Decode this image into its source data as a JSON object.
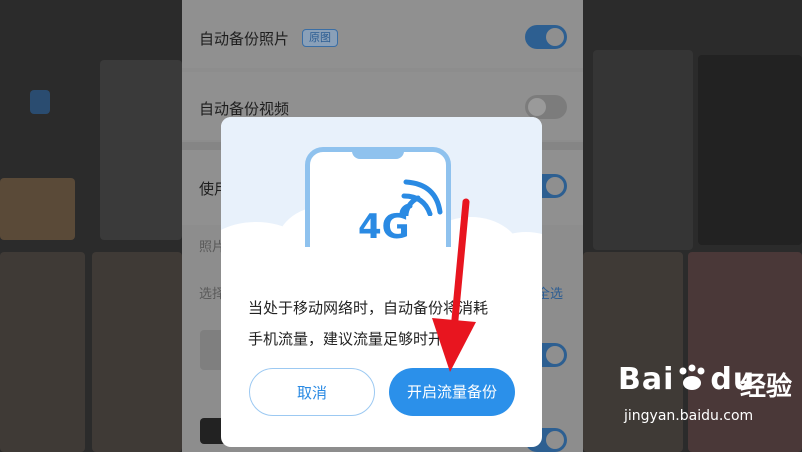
{
  "settings": {
    "auto_backup_photos": "自动备份照片",
    "original_tag": "原图",
    "auto_backup_videos": "自动备份视频",
    "use_partial": "使用",
    "photo_partial": "照片",
    "select_partial": "选择",
    "select_all_partial": "全选"
  },
  "dialog": {
    "badge_text": "4G",
    "message_line1": "当处于移动网络时，自动备份将消耗",
    "message_line2": "手机流量，建议流量足够时开启",
    "cancel_label": "取消",
    "confirm_label": "开启流量备份"
  },
  "watermark": {
    "brand": "Bai",
    "brand_suffix": "du",
    "cn": "经验",
    "url": "jingyan.baidu.com"
  },
  "colors": {
    "accent": "#2b90ea",
    "arrow": "#e8151f",
    "overlay": "#3a3a3a"
  },
  "icons": [
    "wifi-signal-icon",
    "phone-illustration-icon",
    "red-arrow-icon",
    "paw-logo-icon"
  ]
}
